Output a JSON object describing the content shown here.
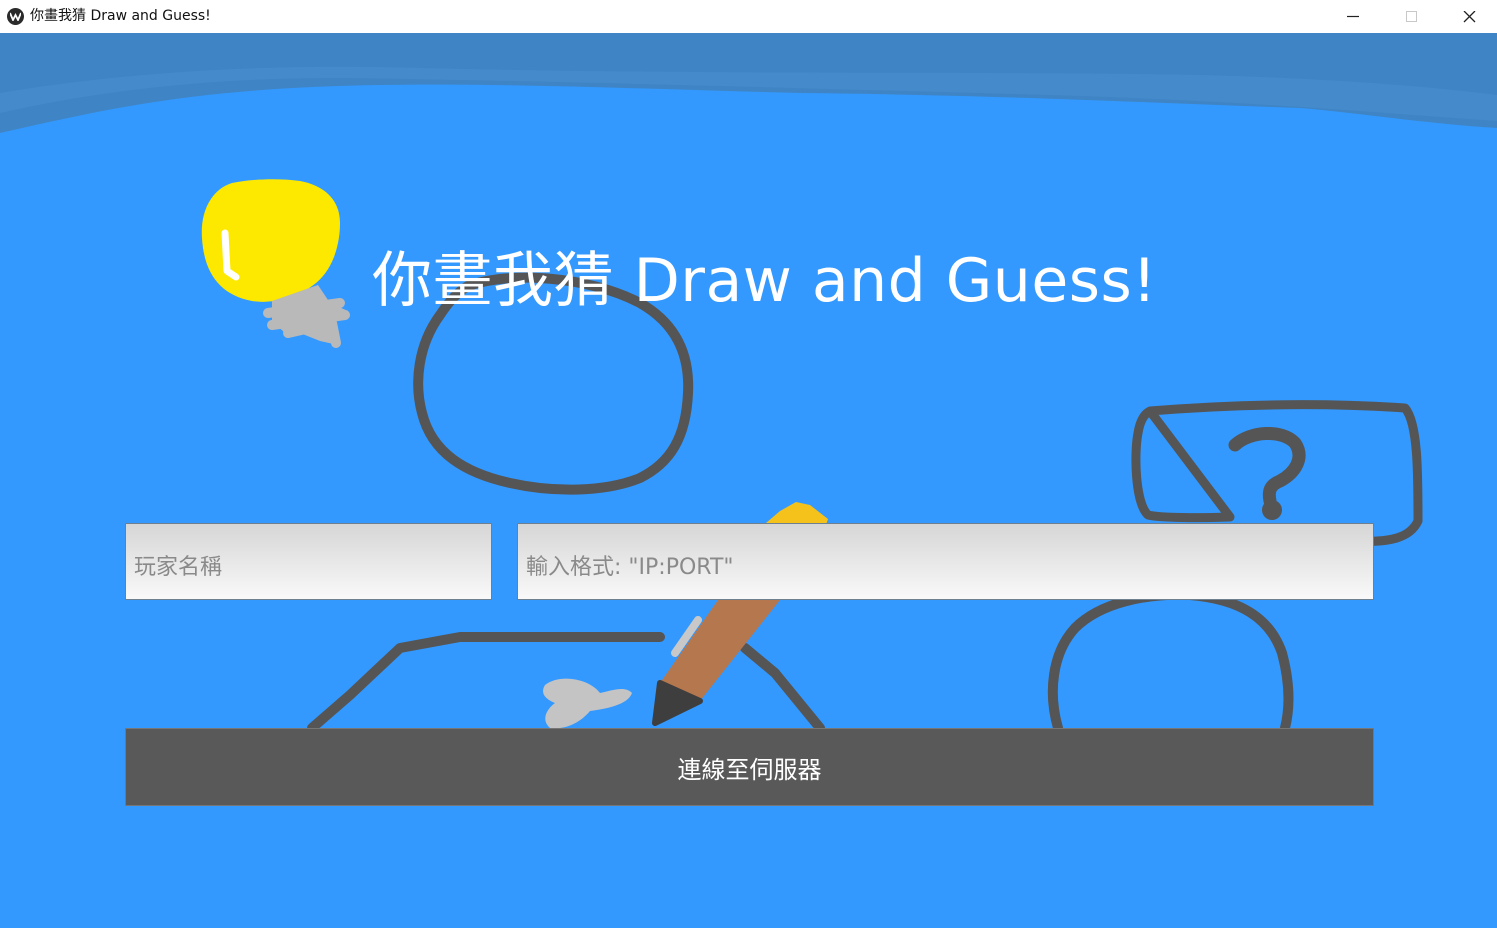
{
  "window": {
    "title": "你畫我猜 Draw and Guess!",
    "icon": "kivy-icon",
    "controls": [
      "minimize-icon",
      "maximize-icon",
      "close-icon"
    ]
  },
  "main": {
    "title": "你畫我猜 Draw and Guess!",
    "background_color": "#3399ff",
    "player_name": {
      "value": "",
      "placeholder": "玩家名稱"
    },
    "server_address": {
      "value": "",
      "placeholder": "輸入格式: \"IP:PORT\""
    },
    "connect_label": "連線至伺服器"
  },
  "doodles": [
    "lightbulb-doodle",
    "head-outline-doodle",
    "pencil-doodle",
    "table-doodle",
    "question-bubble-doodle",
    "guesser-head-doodle"
  ]
}
